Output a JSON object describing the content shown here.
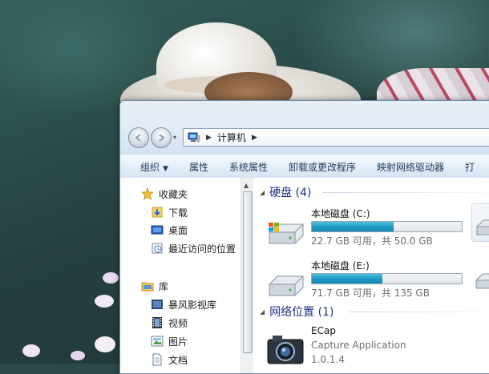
{
  "address_bar": {
    "location": "计算机"
  },
  "toolbar": {
    "items": [
      "组织",
      "属性",
      "系统属性",
      "卸载或更改程序",
      "映射网络驱动器",
      "打"
    ]
  },
  "nav_pane": {
    "favorites": {
      "label": "收藏夹",
      "items": [
        "下载",
        "桌面",
        "最近访问的位置"
      ]
    },
    "libraries": {
      "label": "库",
      "items": [
        "暴风影视库",
        "视频",
        "图片",
        "文档"
      ]
    }
  },
  "hard_disks": {
    "header": "硬盘 (4)",
    "drives": [
      {
        "name": "本地磁盘 (C:)",
        "info": "22.7 GB 可用，共 50.0 GB",
        "used_fraction": 0.546
      },
      {
        "name": "本地磁盘 (E:)",
        "info": "71.7 GB 可用，共 135 GB",
        "used_fraction": 0.469
      }
    ]
  },
  "network": {
    "header": "网络位置 (1)",
    "items": [
      {
        "line1": "ECap",
        "line2": "Capture Application",
        "line3": "1.0.1.4"
      }
    ]
  },
  "colors": {
    "link_blue": "#1e3287",
    "bar_fill": "#1f9ac4",
    "toolbar_text": "#1e395b"
  },
  "icons": [
    "back-arrow-icon",
    "forward-arrow-icon",
    "computer-icon",
    "star-icon",
    "folder-download-icon",
    "desktop-icon",
    "recent-places-icon",
    "library-folder-icon",
    "video-library-icon",
    "film-icon",
    "picture-icon",
    "document-icon",
    "windows-drive-icon",
    "drive-icon",
    "camera-icon"
  ]
}
